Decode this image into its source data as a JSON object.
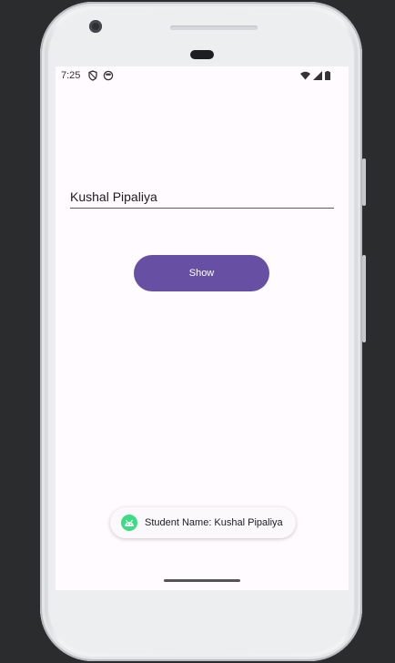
{
  "status_bar": {
    "time": "7:25",
    "left_icons": [
      "shield-icon",
      "face-icon"
    ],
    "right_icons": [
      "wifi-icon",
      "signal-icon",
      "battery-icon"
    ]
  },
  "form": {
    "name_value": "Kushal Pipaliya",
    "show_button_label": "Show"
  },
  "toast": {
    "icon": "android-icon",
    "message": "Student Name: Kushal Pipaliya"
  },
  "colors": {
    "accent": "#6750a4",
    "android_green": "#3ddc84",
    "screen_bg": "#fffbfe",
    "backdrop": "#2b2c2e"
  }
}
